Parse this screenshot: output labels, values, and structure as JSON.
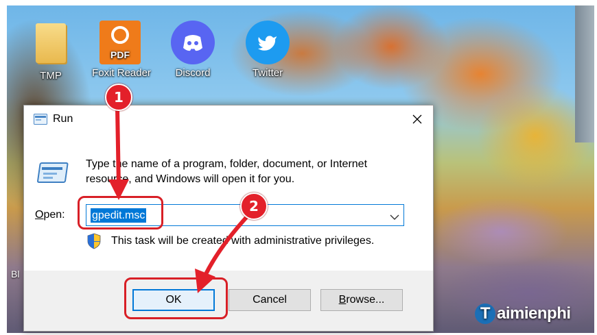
{
  "desktop": {
    "icons": [
      {
        "label": "TMP"
      },
      {
        "label": "Foxit Reader",
        "badge": "PDF"
      },
      {
        "label": "Discord"
      },
      {
        "label": "Twitter"
      }
    ],
    "partial_text": "Bl"
  },
  "dialog": {
    "title": "Run",
    "description": "Type the name of a program, folder, document, or Internet resource, and Windows will open it for you.",
    "open_label_prefix": "O",
    "open_label_rest": "pen:",
    "open_value": "gpedit.msc",
    "admin_note": "This task will be created with administrative privileges.",
    "buttons": {
      "ok": "OK",
      "cancel": "Cancel",
      "browse_prefix": "B",
      "browse_rest": "rowse..."
    }
  },
  "annotations": {
    "step1": "1",
    "step2": "2",
    "accent": "#e3202a"
  },
  "watermark": {
    "logo_letter": "T",
    "text": "aimienphi"
  },
  "colors": {
    "selection": "#0078d7",
    "dialog_bg": "#f0f0f0"
  }
}
